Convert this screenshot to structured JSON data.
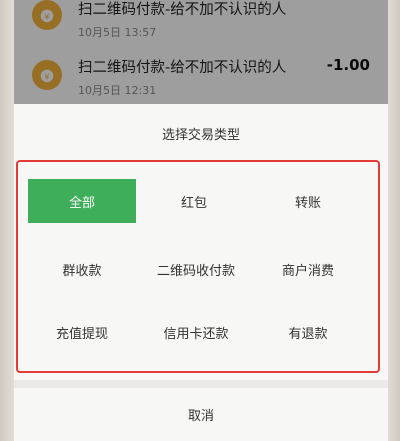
{
  "transactions": [
    {
      "title": "扫二维码付款-给不加不认识的人",
      "time": "10月5日 13:57",
      "amount": ""
    },
    {
      "title": "扫二维码付款-给不加不认识的人",
      "time": "10月5日 12:31",
      "amount": "-1.00"
    }
  ],
  "sheet": {
    "title": "选择交易类型",
    "options": [
      {
        "label": "全部",
        "active": true
      },
      {
        "label": "红包",
        "active": false
      },
      {
        "label": "转账",
        "active": false
      },
      {
        "label": "群收款",
        "active": false
      },
      {
        "label": "二维码收付款",
        "active": false
      },
      {
        "label": "商户消费",
        "active": false
      },
      {
        "label": "充值提现",
        "active": false
      },
      {
        "label": "信用卡还款",
        "active": false
      },
      {
        "label": "有退款",
        "active": false
      }
    ],
    "cancel_label": "取消"
  },
  "colors": {
    "accent_green": "#3fae5a",
    "highlight_red": "#e53a3a",
    "icon_gold": "#f3b33d"
  },
  "icons": {
    "transaction": "coin-bag-icon"
  }
}
